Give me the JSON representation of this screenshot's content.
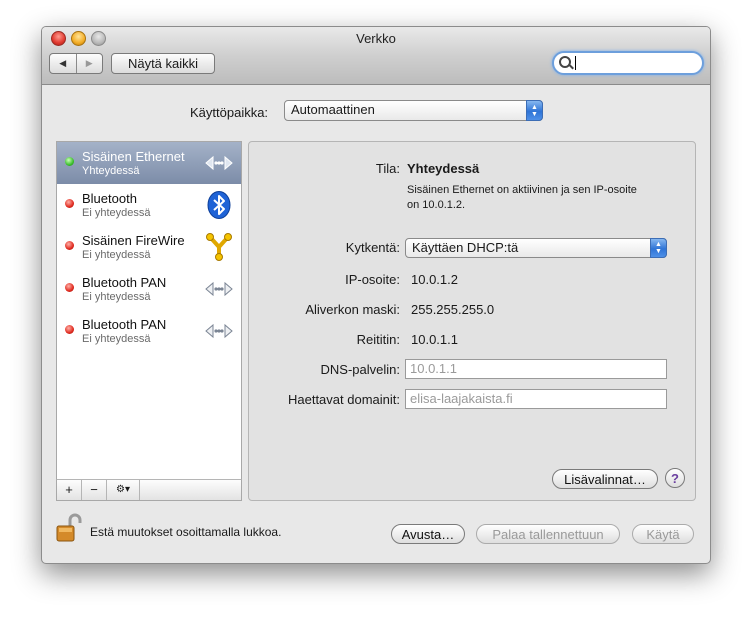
{
  "window": {
    "title": "Verkko"
  },
  "toolbar": {
    "back_glyph": "◀",
    "forward_glyph": "▶",
    "show_all": "Näytä kaikki",
    "search_value": ""
  },
  "location": {
    "label": "Käyttöpaikka:",
    "value": "Automaattinen"
  },
  "services": [
    {
      "name": "Sisäinen Ethernet",
      "status": "Yhteydessä",
      "icon": "ethernet-icon",
      "selected": true,
      "connected": true
    },
    {
      "name": "Bluetooth",
      "status": "Ei yhteydessä",
      "icon": "bluetooth-icon",
      "selected": false,
      "connected": false
    },
    {
      "name": "Sisäinen FireWire",
      "status": "Ei yhteydessä",
      "icon": "firewire-icon",
      "selected": false,
      "connected": false
    },
    {
      "name": "Bluetooth PAN",
      "status": "Ei yhteydessä",
      "icon": "ethernet-icon",
      "selected": false,
      "connected": false
    },
    {
      "name": "Bluetooth PAN",
      "status": "Ei yhteydessä",
      "icon": "ethernet-icon",
      "selected": false,
      "connected": false
    }
  ],
  "sidebar_toolbar": {
    "add": "+",
    "remove": "−",
    "action": "⚙▾"
  },
  "details": {
    "status_label": "Tila:",
    "status_value": "Yhteydessä",
    "status_description": "Sisäinen Ethernet on aktiivinen ja sen IP-osoite on 10.0.1.2.",
    "configure_label": "Kytkentä:",
    "configure_value": "Käyttäen DHCP:tä",
    "ip_label": "IP-osoite:",
    "ip_value": "10.0.1.2",
    "subnet_label": "Aliverkon maski:",
    "subnet_value": "255.255.255.0",
    "router_label": "Reititin:",
    "router_value": "10.0.1.1",
    "dns_label": "DNS-palvelin:",
    "dns_placeholder": "10.0.1.1",
    "search_domains_label": "Haettavat domainit:",
    "search_domains_placeholder": "elisa-laajakaista.fi",
    "advanced_button": "Lisävalinnat…",
    "help_button": "?"
  },
  "footer": {
    "lock_text": "Estä muutokset osoittamalla lukkoa.",
    "assist_button": "Avusta…",
    "revert_button": "Palaa tallennettuun",
    "apply_button": "Käytä"
  },
  "colors": {
    "selection": "#8593ae",
    "focus_ring": "#6d9fdc",
    "status_green": "#3bbf2b",
    "status_red": "#e02a1f"
  }
}
